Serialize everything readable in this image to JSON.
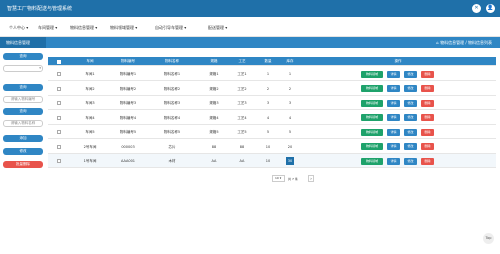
{
  "app": {
    "title": "智慧工厂物料配送与管理系统"
  },
  "nav": [
    "个人中心",
    "车间管理",
    "物料信息管理",
    "物料领域管理",
    "自动引导车管理",
    "配送管理"
  ],
  "crumb": {
    "tab": "物料信息管理",
    "path": "物料信息管理 / 物料信息列表"
  },
  "side": {
    "query": "查询",
    "input1_ph": "请输入物料编号",
    "input2_ph": "请输入物料名称",
    "add": "添加",
    "edit": "修改",
    "delete": "批量删除"
  },
  "table": {
    "headers": [
      "车间",
      "物料编号",
      "物料名称",
      "规格",
      "工艺",
      "数量",
      "库存",
      "操作"
    ],
    "rows": [
      [
        "车间1",
        "物料编号1",
        "物料名称1",
        "规格1",
        "工艺1",
        "1",
        "1"
      ],
      [
        "车间2",
        "物料编号2",
        "物料名称2",
        "规格2",
        "工艺2",
        "2",
        "2"
      ],
      [
        "车间3",
        "物料编号3",
        "物料名称3",
        "规格3",
        "工艺3",
        "3",
        "3"
      ],
      [
        "车间4",
        "物料编号4",
        "物料名称4",
        "规格4",
        "工艺4",
        "4",
        "4"
      ],
      [
        "车间5",
        "物料编号5",
        "物料名称5",
        "规格5",
        "工艺5",
        "5",
        "5"
      ],
      [
        "2号车间",
        "000003",
        "芯片",
        "88",
        "88",
        "10",
        "20"
      ],
      [
        "1号车间",
        "AAA001",
        "木材",
        "AA",
        "AA",
        "10",
        "30"
      ]
    ],
    "actions": {
      "apply": "物料领域",
      "detail": "详情",
      "edit": "修改",
      "delete": "删除"
    }
  },
  "pager": {
    "size": "10",
    "text": "共 7 条"
  },
  "backtop": "Top"
}
